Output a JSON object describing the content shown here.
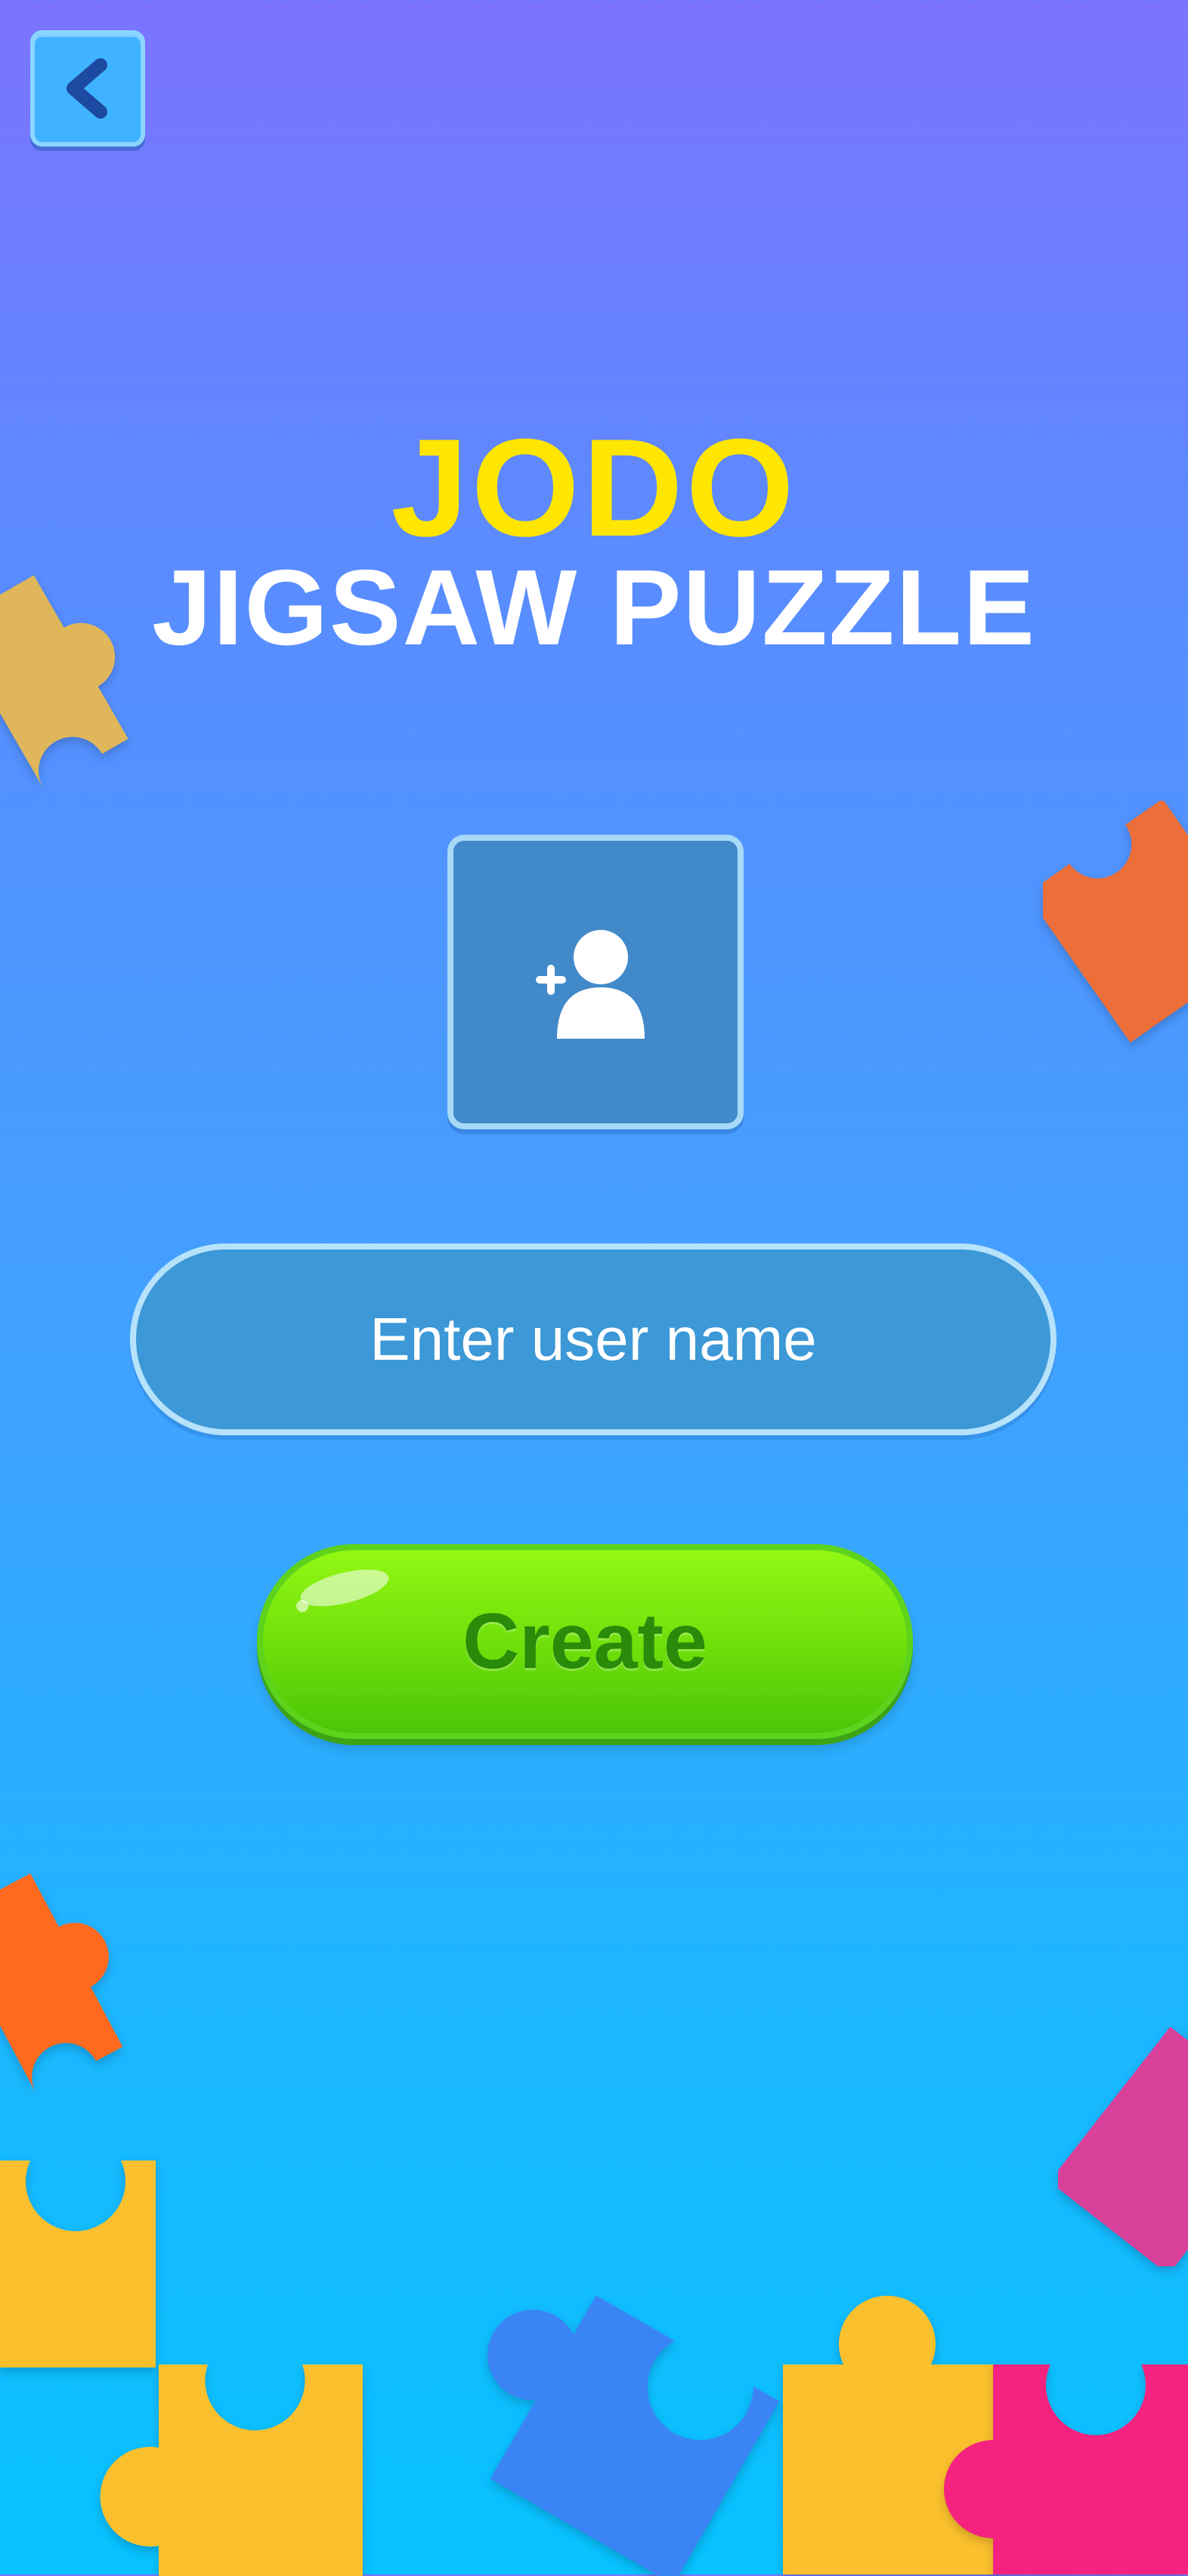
{
  "header": {
    "back_icon": "chevron-left-icon"
  },
  "title": {
    "brand": "JODO",
    "subtitle": "JIGSAW PUZZLE"
  },
  "avatar": {
    "icon": "add-user-icon"
  },
  "form": {
    "username_placeholder": "Enter user name",
    "username_value": "",
    "create_label": "Create"
  },
  "colors": {
    "brand_yellow": "#ffe600",
    "button_green": "#6ede0b",
    "create_text": "#2a8a0a",
    "background_top": "#7b73ff",
    "background_bottom": "#07c2ff"
  },
  "decorations": [
    "puzzle-piece-yellow",
    "puzzle-piece-orange",
    "puzzle-piece-pink",
    "puzzle-piece-blue",
    "puzzle-piece-magenta"
  ]
}
